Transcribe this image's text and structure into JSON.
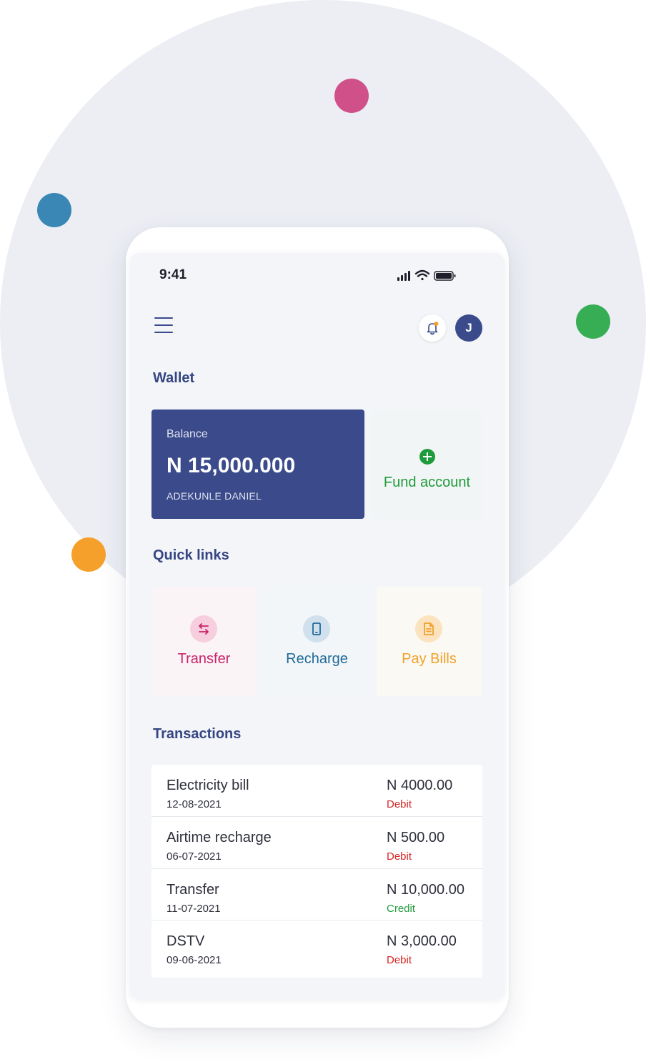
{
  "status_bar": {
    "time": "9:41"
  },
  "header": {
    "avatar_initial": "J"
  },
  "wallet": {
    "title": "Wallet",
    "balance_label": "Balance",
    "balance_amount": "N 15,000.000",
    "account_name": "ADEKUNLE DANIEL",
    "fund_label": "Fund account"
  },
  "quick_links": {
    "title": "Quick links",
    "items": [
      {
        "label": "Transfer",
        "icon": "transfer-icon"
      },
      {
        "label": "Recharge",
        "icon": "phone-icon"
      },
      {
        "label": "Pay Bills",
        "icon": "document-icon"
      }
    ]
  },
  "transactions": {
    "title": "Transactions",
    "rows": [
      {
        "name": "Electricity bill",
        "date": "12-08-2021",
        "amount": "N 4000.00",
        "type": "Debit"
      },
      {
        "name": "Airtime recharge",
        "date": "06-07-2021",
        "amount": "N 500.00",
        "type": "Debit"
      },
      {
        "name": "Transfer",
        "date": "11-07-2021",
        "amount": "N 10,000.00",
        "type": "Credit"
      },
      {
        "name": "DSTV",
        "date": "09-06-2021",
        "amount": "N 3,000.00",
        "type": "Debit"
      }
    ]
  },
  "colors": {
    "primary": "#3a4a8a",
    "credit": "#1f9b3c",
    "debit": "#d62424",
    "transfer": "#c8236a",
    "recharge": "#226a98",
    "bills": "#f0a12c"
  }
}
